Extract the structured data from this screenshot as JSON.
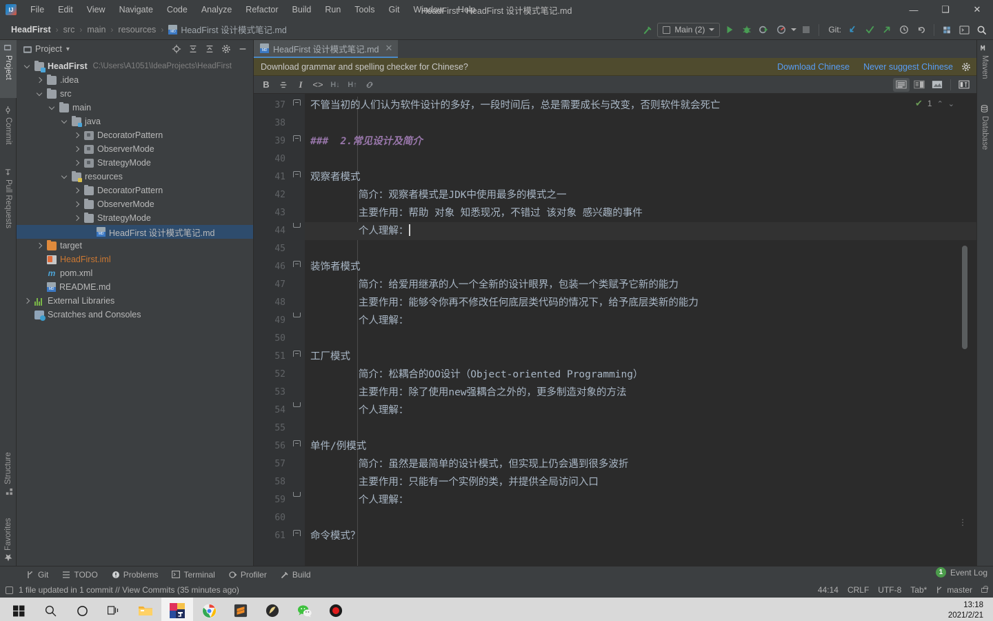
{
  "window": {
    "title": "HeadFirst - HeadFirst 设计模式笔记.md",
    "app_icon": "intellij-idea-logo",
    "controls": {
      "minimize": "—",
      "maximize": "❑",
      "close": "✕"
    }
  },
  "menu": [
    "File",
    "Edit",
    "View",
    "Navigate",
    "Code",
    "Analyze",
    "Refactor",
    "Build",
    "Run",
    "Tools",
    "Git",
    "Window",
    "Help"
  ],
  "breadcrumb": {
    "items": [
      "HeadFirst",
      "src",
      "main",
      "resources"
    ],
    "file": "HeadFirst 设计模式笔记.md",
    "separator": "›"
  },
  "toolbar": {
    "build_label": "build-hammer",
    "run_config": "Main (2)",
    "run": "▶",
    "debug": "debug-bug",
    "coverage": "run-with-coverage",
    "profile": "profiler",
    "stop": "■",
    "git_label": "Git:",
    "git_update": "update-project",
    "git_commit": "commit",
    "git_push": "push",
    "git_history": "history",
    "git_rollback": "rollback",
    "search_everywhere": "search-icon",
    "settings": "settings-icon",
    "terminal_toggle": "terminal-icon"
  },
  "left_tool_tabs": [
    {
      "label": "Project",
      "icon": "project-icon",
      "selected": true
    },
    {
      "label": "Commit",
      "icon": "commit-icon",
      "selected": false
    },
    {
      "label": "Pull Requests",
      "icon": "pull-request-icon",
      "selected": false
    }
  ],
  "left_tool_tabs_bottom": [
    {
      "label": "Structure",
      "icon": "structure-icon"
    },
    {
      "label": "Favorites",
      "icon": "star-icon"
    }
  ],
  "right_tool_tabs": [
    {
      "label": "Maven",
      "icon": "maven-icon"
    },
    {
      "label": "Database",
      "icon": "database-icon"
    }
  ],
  "project_panel": {
    "title": "Project",
    "dropdown": "▾",
    "actions": [
      "locate-icon",
      "expand-all-icon",
      "collapse-all-icon",
      "gear-icon",
      "hide-icon"
    ],
    "tree": [
      {
        "depth": 0,
        "arrow": "down",
        "icon": "proj",
        "label": "HeadFirst",
        "bold": true,
        "path": "C:\\Users\\A1051\\IdeaProjects\\HeadFirst"
      },
      {
        "depth": 1,
        "arrow": "right",
        "icon": "folder",
        "label": ".idea"
      },
      {
        "depth": 1,
        "arrow": "down",
        "icon": "folder",
        "label": "src"
      },
      {
        "depth": 2,
        "arrow": "down",
        "icon": "folder",
        "label": "main"
      },
      {
        "depth": 3,
        "arrow": "down",
        "icon": "srcroot",
        "label": "java"
      },
      {
        "depth": 4,
        "arrow": "right",
        "icon": "pkg",
        "label": "DecoratorPattern"
      },
      {
        "depth": 4,
        "arrow": "right",
        "icon": "pkg",
        "label": "ObserverMode"
      },
      {
        "depth": 4,
        "arrow": "right",
        "icon": "pkg",
        "label": "StrategyMode"
      },
      {
        "depth": 3,
        "arrow": "down",
        "icon": "resroot",
        "label": "resources"
      },
      {
        "depth": 4,
        "arrow": "right",
        "icon": "folder",
        "label": "DecoratorPattern"
      },
      {
        "depth": 4,
        "arrow": "right",
        "icon": "folder",
        "label": "ObserverMode"
      },
      {
        "depth": 4,
        "arrow": "right",
        "icon": "folder",
        "label": "StrategyMode"
      },
      {
        "depth": 5,
        "arrow": "none",
        "icon": "md",
        "label": "HeadFirst 设计模式笔记.md",
        "selected": true
      },
      {
        "depth": 1,
        "arrow": "right",
        "icon": "target",
        "label": "target"
      },
      {
        "depth": 1,
        "arrow": "none",
        "icon": "iml",
        "label": "HeadFirst.iml",
        "orange": true
      },
      {
        "depth": 1,
        "arrow": "none",
        "icon": "xml",
        "label": "pom.xml"
      },
      {
        "depth": 1,
        "arrow": "none",
        "icon": "md",
        "label": "README.md"
      },
      {
        "depth": 0,
        "arrow": "right",
        "icon": "lib",
        "label": "External Libraries"
      },
      {
        "depth": 0,
        "arrow": "none",
        "icon": "scr",
        "label": "Scratches and Consoles"
      }
    ]
  },
  "editor": {
    "tab": {
      "label": "HeadFirst 设计模式笔记.md",
      "icon": "markdown-icon",
      "close": "✕"
    },
    "notification": {
      "message": "Download grammar and spelling checker for Chinese?",
      "action_primary": "Download Chinese",
      "action_secondary": "Never suggest Chinese",
      "settings_icon": "gear-icon"
    },
    "md_toolbar": {
      "bold": "B",
      "strikethrough": "S",
      "italic": "I",
      "code": "<>",
      "header_down": "H↓",
      "header_up": "H↑",
      "link": "link-icon",
      "view_editor": "editor-only-view",
      "view_split": "split-view",
      "view_preview": "preview-view",
      "view_toggle": "toggle-preview"
    },
    "inspection": {
      "count": "1",
      "icon": "inspection-check",
      "up": "⌃",
      "down": "⌄"
    },
    "first_line": 37,
    "lines": [
      {
        "n": 37,
        "text": "不管当初的人们认为软件设计的多好，一段时间后，总是需要成长与改变，否则软件就会死亡",
        "indent": 0,
        "fold": "top",
        "style": "plain"
      },
      {
        "n": 38,
        "text": "",
        "indent": 0,
        "fold": "none",
        "style": "plain"
      },
      {
        "n": 39,
        "text": "###  2.常见设计及简介",
        "indent": 0,
        "fold": "top",
        "style": "heading"
      },
      {
        "n": 40,
        "text": "",
        "indent": 0,
        "fold": "none",
        "style": "plain"
      },
      {
        "n": 41,
        "text": "观察者模式",
        "indent": 0,
        "fold": "top",
        "style": "plain"
      },
      {
        "n": 42,
        "text": "        简介：观察者模式是JDK中使用最多的模式之一",
        "indent": 1,
        "fold": "none",
        "style": "plain"
      },
      {
        "n": 43,
        "text": "        主要作用：帮助 对象 知悉现况，不错过 该对象 感兴趣的事件",
        "indent": 1,
        "fold": "none",
        "style": "plain"
      },
      {
        "n": 44,
        "text": "        个人理解：",
        "indent": 1,
        "fold": "bot",
        "style": "plain",
        "current": true,
        "caret": true
      },
      {
        "n": 45,
        "text": "",
        "indent": 0,
        "fold": "none",
        "style": "plain"
      },
      {
        "n": 46,
        "text": "装饰者模式",
        "indent": 0,
        "fold": "top",
        "style": "plain"
      },
      {
        "n": 47,
        "text": "        简介：给爱用继承的人一个全新的设计眼界，包装一个类赋予它新的能力",
        "indent": 1,
        "fold": "none",
        "style": "plain"
      },
      {
        "n": 48,
        "text": "        主要作用：能够令你再不修改任何底层类代码的情况下，给予底层类新的能力",
        "indent": 1,
        "fold": "none",
        "style": "plain"
      },
      {
        "n": 49,
        "text": "        个人理解：",
        "indent": 1,
        "fold": "bot",
        "style": "plain"
      },
      {
        "n": 50,
        "text": "",
        "indent": 0,
        "fold": "none",
        "style": "plain"
      },
      {
        "n": 51,
        "text": "工厂模式",
        "indent": 0,
        "fold": "top",
        "style": "plain"
      },
      {
        "n": 52,
        "text": "        简介：松耦合的OO设计（Object-oriented Programming）",
        "indent": 1,
        "fold": "none",
        "style": "plain"
      },
      {
        "n": 53,
        "text": "        主要作用：除了使用new强耦合之外的，更多制造对象的方法",
        "indent": 1,
        "fold": "none",
        "style": "plain"
      },
      {
        "n": 54,
        "text": "        个人理解：",
        "indent": 1,
        "fold": "bot",
        "style": "plain"
      },
      {
        "n": 55,
        "text": "",
        "indent": 0,
        "fold": "none",
        "style": "plain"
      },
      {
        "n": 56,
        "text": "单件/例模式",
        "indent": 0,
        "fold": "top",
        "style": "plain"
      },
      {
        "n": 57,
        "text": "        简介：虽然是最简单的设计模式，但实现上仍会遇到很多波折",
        "indent": 1,
        "fold": "none",
        "style": "plain"
      },
      {
        "n": 58,
        "text": "        主要作用：只能有一个实例的类，并提供全局访问入口",
        "indent": 1,
        "fold": "none",
        "style": "plain"
      },
      {
        "n": 59,
        "text": "        个人理解：",
        "indent": 1,
        "fold": "bot",
        "style": "plain"
      },
      {
        "n": 60,
        "text": "",
        "indent": 0,
        "fold": "none",
        "style": "plain"
      },
      {
        "n": 61,
        "text": "命令模式？",
        "indent": 0,
        "fold": "top",
        "style": "plain"
      }
    ]
  },
  "bottom_tool_windows": [
    {
      "label": "Git",
      "icon": "git-branch-icon"
    },
    {
      "label": "TODO",
      "icon": "todo-list-icon"
    },
    {
      "label": "Problems",
      "icon": "problems-icon"
    },
    {
      "label": "Terminal",
      "icon": "terminal-icon"
    },
    {
      "label": "Profiler",
      "icon": "profiler-icon"
    },
    {
      "label": "Build",
      "icon": "build-hammer-icon"
    }
  ],
  "status_bar": {
    "message": "1 file updated in 1 commit // View Commits (35 minutes ago)",
    "message_icon": "widget-icon",
    "event_log": "Event Log",
    "event_count": "1",
    "caret_position": "44:14",
    "line_separator": "CRLF",
    "encoding": "UTF-8",
    "indent": "Tab*",
    "branch": "master",
    "branch_icon": "git-branch-icon",
    "lock_icon": "lock-icon"
  },
  "taskbar": {
    "items": [
      {
        "name": "start-button",
        "icon": "windows-logo",
        "running": false,
        "active": false
      },
      {
        "name": "search-button",
        "icon": "search-icon",
        "running": false,
        "active": false
      },
      {
        "name": "cortana-button",
        "icon": "circle-icon",
        "running": false,
        "active": false
      },
      {
        "name": "task-view",
        "icon": "task-view-icon",
        "running": false,
        "active": false
      },
      {
        "name": "file-explorer",
        "icon": "folder-icon",
        "running": true,
        "active": false
      },
      {
        "name": "intellij-idea",
        "icon": "intellij-icon",
        "running": true,
        "active": true
      },
      {
        "name": "google-chrome",
        "icon": "chrome-icon",
        "running": true,
        "active": false
      },
      {
        "name": "sublime-text",
        "icon": "sublime-icon",
        "running": true,
        "active": false
      },
      {
        "name": "navicat",
        "icon": "navicat-icon",
        "running": true,
        "active": false
      },
      {
        "name": "wechat",
        "icon": "wechat-icon",
        "running": true,
        "active": false
      },
      {
        "name": "screen-recorder",
        "icon": "record-icon",
        "running": true,
        "active": false
      }
    ],
    "time": "13:18",
    "date": "2021/2/21"
  },
  "colors": {
    "accent_blue": "#4a88c7",
    "link_blue": "#589df6",
    "notification_bg": "#4f4b2e",
    "heading_purple": "#9876aa",
    "selection_blue": "#2e4c6d",
    "panel_bg": "#3c3f41",
    "editor_bg": "#2b2b2b",
    "green": "#4c9c4c"
  }
}
